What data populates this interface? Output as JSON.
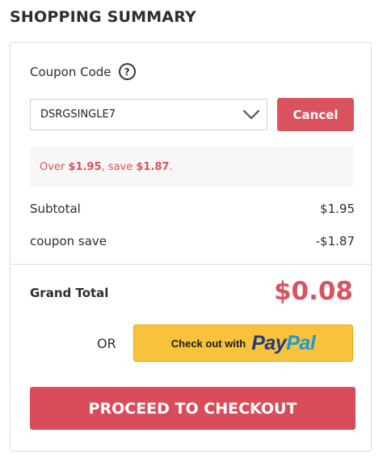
{
  "summary": {
    "title": "SHOPPING SUMMARY"
  },
  "coupon": {
    "label": "Coupon Code",
    "help_icon": "question-circle-icon",
    "help_glyph": "?",
    "selected": "DSRGSINGLE7",
    "cancel_label": "Cancel",
    "notice": {
      "prefix": "Over ",
      "threshold": "$1.95",
      "middle": ", save ",
      "amount": "$1.87",
      "suffix": "."
    }
  },
  "totals": {
    "subtotal_label": "Subtotal",
    "subtotal_value": "$1.95",
    "coupon_label": "coupon save",
    "coupon_value": "-$1.87",
    "grand_label": "Grand Total",
    "grand_value": "$0.08"
  },
  "paypal": {
    "or_text": "OR",
    "prefix": "Check out with",
    "logo_part1": "Pay",
    "logo_part2": "Pal"
  },
  "checkout": {
    "label": "PROCEED TO CHECKOUT"
  },
  "colors": {
    "accent": "#d9535e",
    "paypal_yellow": "#f8c33a",
    "paypal_dark_blue": "#253b80",
    "paypal_light_blue": "#179bd7"
  }
}
